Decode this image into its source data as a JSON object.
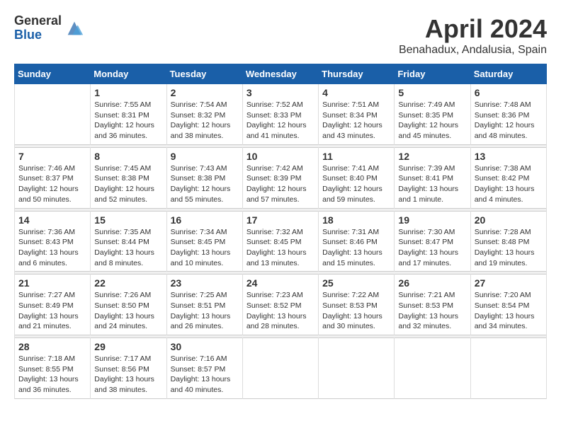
{
  "header": {
    "logo_general": "General",
    "logo_blue": "Blue",
    "month": "April 2024",
    "location": "Benahadux, Andalusia, Spain"
  },
  "days_of_week": [
    "Sunday",
    "Monday",
    "Tuesday",
    "Wednesday",
    "Thursday",
    "Friday",
    "Saturday"
  ],
  "weeks": [
    [
      {
        "day": "",
        "info": ""
      },
      {
        "day": "1",
        "info": "Sunrise: 7:55 AM\nSunset: 8:31 PM\nDaylight: 12 hours\nand 36 minutes."
      },
      {
        "day": "2",
        "info": "Sunrise: 7:54 AM\nSunset: 8:32 PM\nDaylight: 12 hours\nand 38 minutes."
      },
      {
        "day": "3",
        "info": "Sunrise: 7:52 AM\nSunset: 8:33 PM\nDaylight: 12 hours\nand 41 minutes."
      },
      {
        "day": "4",
        "info": "Sunrise: 7:51 AM\nSunset: 8:34 PM\nDaylight: 12 hours\nand 43 minutes."
      },
      {
        "day": "5",
        "info": "Sunrise: 7:49 AM\nSunset: 8:35 PM\nDaylight: 12 hours\nand 45 minutes."
      },
      {
        "day": "6",
        "info": "Sunrise: 7:48 AM\nSunset: 8:36 PM\nDaylight: 12 hours\nand 48 minutes."
      }
    ],
    [
      {
        "day": "7",
        "info": "Sunrise: 7:46 AM\nSunset: 8:37 PM\nDaylight: 12 hours\nand 50 minutes."
      },
      {
        "day": "8",
        "info": "Sunrise: 7:45 AM\nSunset: 8:38 PM\nDaylight: 12 hours\nand 52 minutes."
      },
      {
        "day": "9",
        "info": "Sunrise: 7:43 AM\nSunset: 8:38 PM\nDaylight: 12 hours\nand 55 minutes."
      },
      {
        "day": "10",
        "info": "Sunrise: 7:42 AM\nSunset: 8:39 PM\nDaylight: 12 hours\nand 57 minutes."
      },
      {
        "day": "11",
        "info": "Sunrise: 7:41 AM\nSunset: 8:40 PM\nDaylight: 12 hours\nand 59 minutes."
      },
      {
        "day": "12",
        "info": "Sunrise: 7:39 AM\nSunset: 8:41 PM\nDaylight: 13 hours\nand 1 minute."
      },
      {
        "day": "13",
        "info": "Sunrise: 7:38 AM\nSunset: 8:42 PM\nDaylight: 13 hours\nand 4 minutes."
      }
    ],
    [
      {
        "day": "14",
        "info": "Sunrise: 7:36 AM\nSunset: 8:43 PM\nDaylight: 13 hours\nand 6 minutes."
      },
      {
        "day": "15",
        "info": "Sunrise: 7:35 AM\nSunset: 8:44 PM\nDaylight: 13 hours\nand 8 minutes."
      },
      {
        "day": "16",
        "info": "Sunrise: 7:34 AM\nSunset: 8:45 PM\nDaylight: 13 hours\nand 10 minutes."
      },
      {
        "day": "17",
        "info": "Sunrise: 7:32 AM\nSunset: 8:45 PM\nDaylight: 13 hours\nand 13 minutes."
      },
      {
        "day": "18",
        "info": "Sunrise: 7:31 AM\nSunset: 8:46 PM\nDaylight: 13 hours\nand 15 minutes."
      },
      {
        "day": "19",
        "info": "Sunrise: 7:30 AM\nSunset: 8:47 PM\nDaylight: 13 hours\nand 17 minutes."
      },
      {
        "day": "20",
        "info": "Sunrise: 7:28 AM\nSunset: 8:48 PM\nDaylight: 13 hours\nand 19 minutes."
      }
    ],
    [
      {
        "day": "21",
        "info": "Sunrise: 7:27 AM\nSunset: 8:49 PM\nDaylight: 13 hours\nand 21 minutes."
      },
      {
        "day": "22",
        "info": "Sunrise: 7:26 AM\nSunset: 8:50 PM\nDaylight: 13 hours\nand 24 minutes."
      },
      {
        "day": "23",
        "info": "Sunrise: 7:25 AM\nSunset: 8:51 PM\nDaylight: 13 hours\nand 26 minutes."
      },
      {
        "day": "24",
        "info": "Sunrise: 7:23 AM\nSunset: 8:52 PM\nDaylight: 13 hours\nand 28 minutes."
      },
      {
        "day": "25",
        "info": "Sunrise: 7:22 AM\nSunset: 8:53 PM\nDaylight: 13 hours\nand 30 minutes."
      },
      {
        "day": "26",
        "info": "Sunrise: 7:21 AM\nSunset: 8:53 PM\nDaylight: 13 hours\nand 32 minutes."
      },
      {
        "day": "27",
        "info": "Sunrise: 7:20 AM\nSunset: 8:54 PM\nDaylight: 13 hours\nand 34 minutes."
      }
    ],
    [
      {
        "day": "28",
        "info": "Sunrise: 7:18 AM\nSunset: 8:55 PM\nDaylight: 13 hours\nand 36 minutes."
      },
      {
        "day": "29",
        "info": "Sunrise: 7:17 AM\nSunset: 8:56 PM\nDaylight: 13 hours\nand 38 minutes."
      },
      {
        "day": "30",
        "info": "Sunrise: 7:16 AM\nSunset: 8:57 PM\nDaylight: 13 hours\nand 40 minutes."
      },
      {
        "day": "",
        "info": ""
      },
      {
        "day": "",
        "info": ""
      },
      {
        "day": "",
        "info": ""
      },
      {
        "day": "",
        "info": ""
      }
    ]
  ]
}
